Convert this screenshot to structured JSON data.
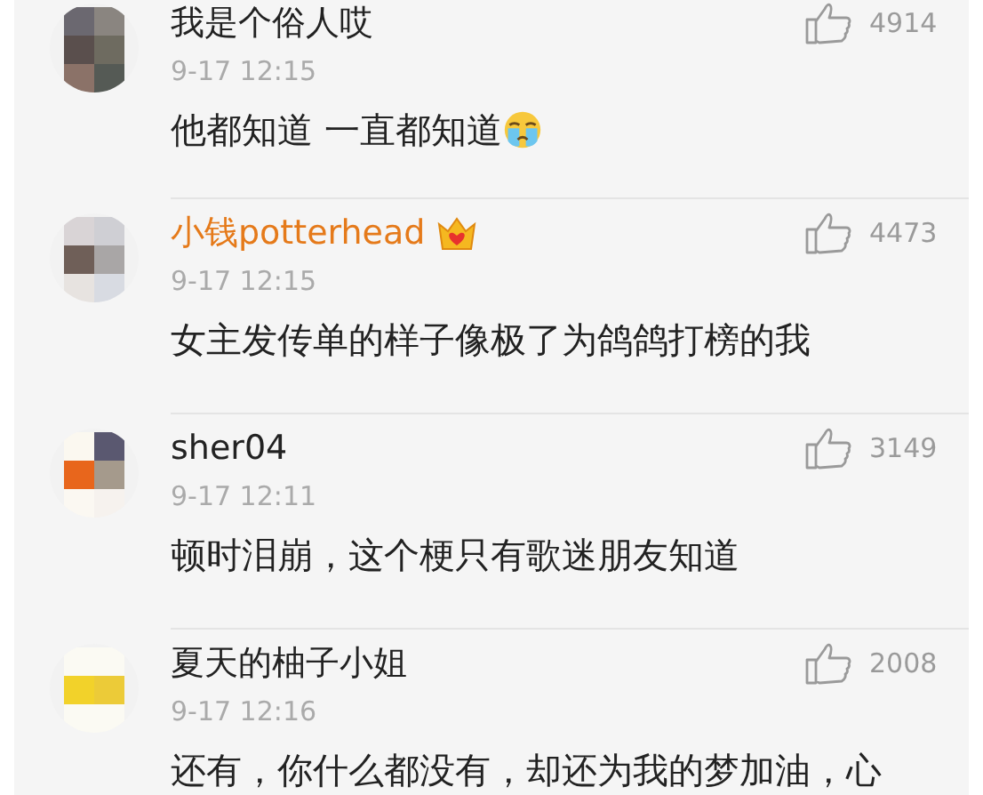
{
  "comments": [
    {
      "user": "我是个俗人哎",
      "vip": false,
      "badge": false,
      "time": "9-17 12:15",
      "text": "他都知道 一直都知道",
      "emoji": true,
      "likes": "4914"
    },
    {
      "user": "小钱potterhead",
      "vip": true,
      "badge": true,
      "time": "9-17 12:15",
      "text": "女主发传单的样子像极了为鸽鸽打榜的我",
      "emoji": false,
      "likes": "4473"
    },
    {
      "user": "sher04",
      "vip": false,
      "badge": false,
      "time": "9-17 12:11",
      "text": "顿时泪崩，这个梗只有歌迷朋友知道",
      "emoji": false,
      "likes": "3149"
    },
    {
      "user": "夏天的柚子小姐",
      "vip": false,
      "badge": false,
      "time": "9-17 12:16",
      "text": "还有，你什么都没有，却还为我的梦加油，心",
      "emoji": false,
      "likes": "2008"
    }
  ]
}
